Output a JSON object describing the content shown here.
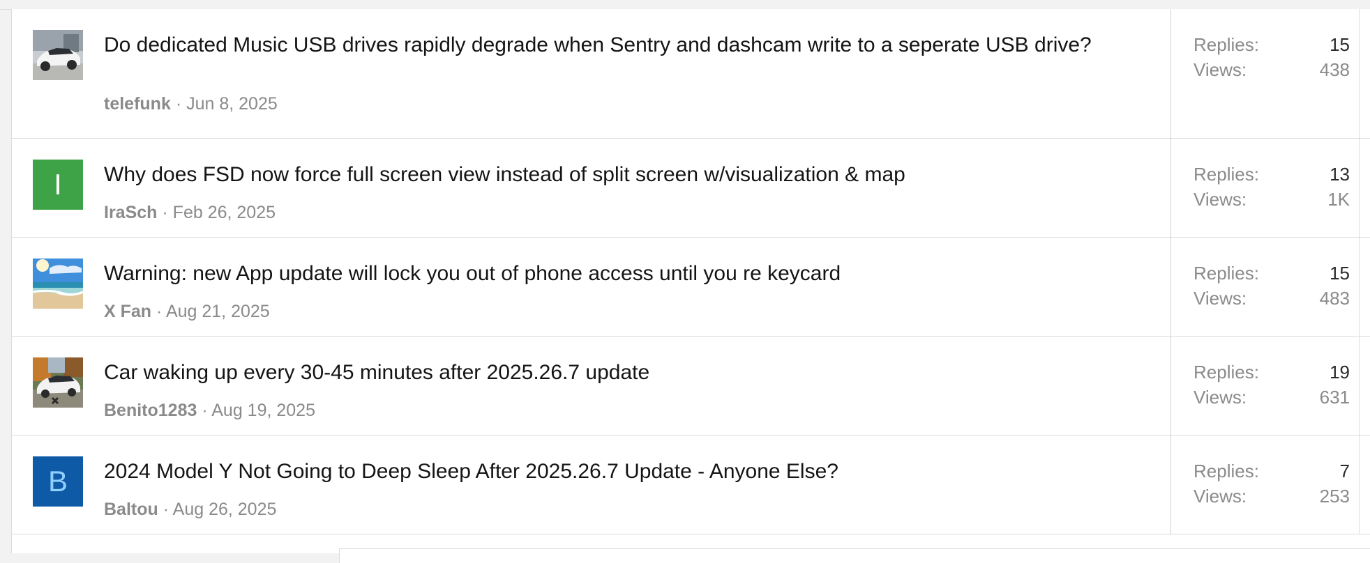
{
  "threads": [
    {
      "title": "Do dedicated Music USB drives rapidly degrade when Sentry and dashcam write to a seperate USB drive?",
      "author": "telefunk",
      "date": "Jun 8, 2025",
      "replies_label": "Replies:",
      "replies": "15",
      "views_label": "Views:",
      "views": "438",
      "avatar": {
        "type": "image",
        "icon": "white-car-photo-icon"
      }
    },
    {
      "title": "Why does FSD now force full screen view instead of split screen w/visualization & map",
      "author": "IraSch",
      "date": "Feb 26, 2025",
      "replies_label": "Replies:",
      "replies": "13",
      "views_label": "Views:",
      "views": "1K",
      "avatar": {
        "type": "letter",
        "letter": "I",
        "bg": "#3ea346",
        "fg": "#ffffff"
      }
    },
    {
      "title": "Warning: new App update will lock you out of phone access until you re keycard",
      "author": "X Fan",
      "date": "Aug 21, 2025",
      "replies_label": "Replies:",
      "replies": "15",
      "views_label": "Views:",
      "views": "483",
      "avatar": {
        "type": "image",
        "icon": "beach-photo-icon"
      }
    },
    {
      "title": "Car waking up every 30-45 minutes after 2025.26.7 update",
      "author": "Benito1283",
      "date": "Aug 19, 2025",
      "replies_label": "Replies:",
      "replies": "19",
      "views_label": "Views:",
      "views": "631",
      "avatar": {
        "type": "image",
        "icon": "white-suv-photo-icon"
      }
    },
    {
      "title": "2024 Model Y Not Going to Deep Sleep After 2025.26.7 Update - Anyone Else?",
      "author": "Baltou",
      "date": "Aug 26, 2025",
      "replies_label": "Replies:",
      "replies": "7",
      "views_label": "Views:",
      "views": "253",
      "avatar": {
        "type": "letter",
        "letter": "B",
        "bg": "#0f5aa6",
        "fg": "#8fd0ff"
      }
    }
  ],
  "separator": "·"
}
